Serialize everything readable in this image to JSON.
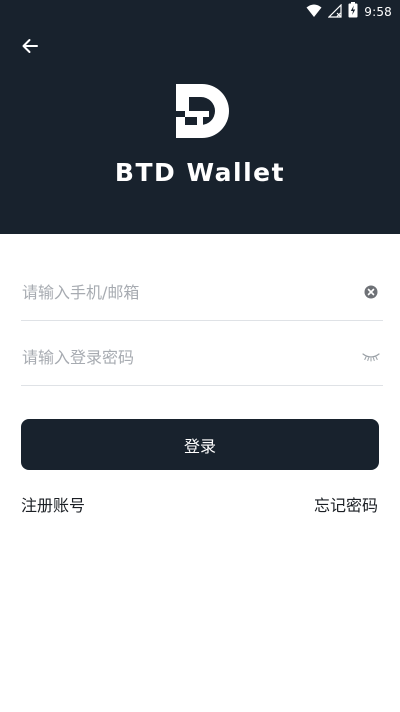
{
  "status_bar": {
    "time": "9:58",
    "icons": [
      "wifi-icon",
      "signal-off-icon",
      "battery-charging-icon"
    ]
  },
  "header": {
    "back_icon": "arrow-left-icon",
    "logo_icon": "btd-logo-icon",
    "app_title": "BTD Wallet",
    "background_color": "#18222d"
  },
  "form": {
    "account": {
      "placeholder": "请输入手机/邮箱",
      "value": "",
      "trailing_icon": "clear-circle-icon"
    },
    "password": {
      "placeholder": "请输入登录密码",
      "value": "",
      "trailing_icon": "eye-closed-icon"
    },
    "login_button_label": "登录"
  },
  "links": {
    "register": "注册账号",
    "forgot_password": "忘记密码"
  }
}
